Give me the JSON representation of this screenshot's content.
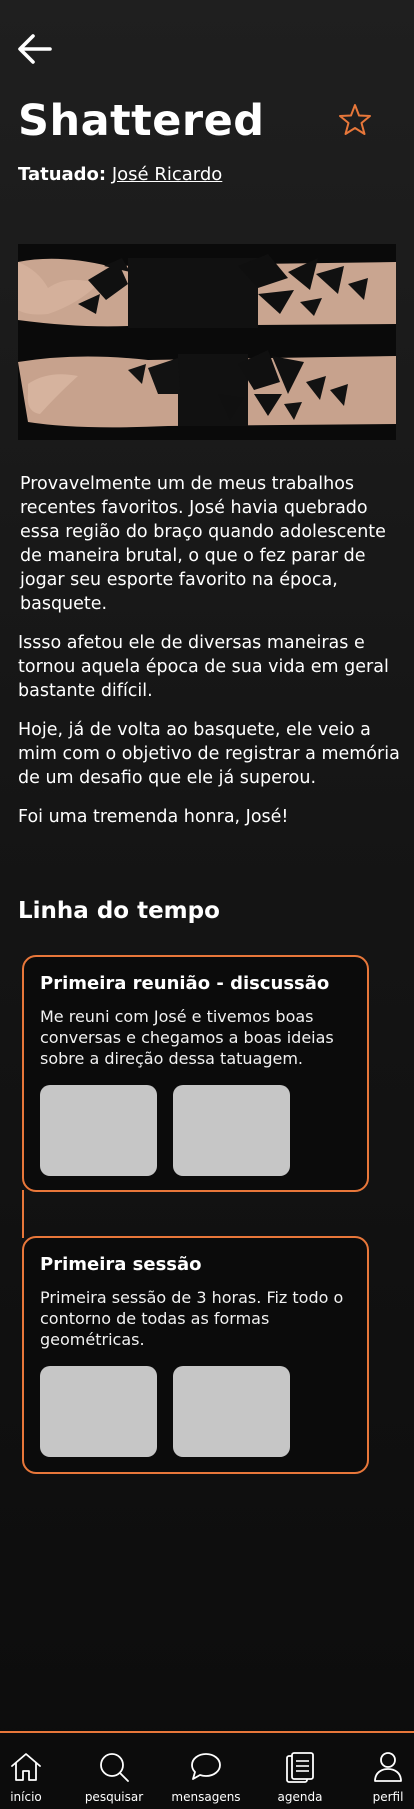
{
  "header": {
    "back_icon": "arrow-left-icon",
    "title": "Shattered",
    "favorite_icon": "star-outline-icon",
    "artist_label": "Tatuado:",
    "artist_name": "José Ricardo"
  },
  "photo": {
    "alt": "forearm-geometric-tattoo"
  },
  "description": {
    "p1": "Provavelmente um de meus trabalhos recentes favoritos. José havia quebrado essa região do braço quando adolescente de maneira brutal, o que o fez parar de jogar seu esporte favorito na época, basquete.",
    "p2": "Issso afetou ele de diversas maneiras e tornou aquela época de sua vida em geral bastante difícil.",
    "p3": "Hoje, já de volta ao basquete, ele veio a mim com o objetivo de registrar a memória de um desafio que ele já superou.",
    "p4": "Foi uma tremenda honra, José!"
  },
  "timeline": {
    "title": "Linha do tempo",
    "items": [
      {
        "title": "Primeira reunião - discussão",
        "text": "Me reuni com José e tivemos boas conversas e chegamos a boas ideias sobre a direção dessa tatuagem."
      },
      {
        "title": "Primeira sessão",
        "text": "Primeira sessão de 3 horas. Fiz todo o contorno de todas as formas geométricas."
      }
    ]
  },
  "nav": {
    "items": [
      {
        "label": "início",
        "icon": "home-icon"
      },
      {
        "label": "pesquisar",
        "icon": "search-icon"
      },
      {
        "label": "mensagens",
        "icon": "chat-icon"
      },
      {
        "label": "agenda",
        "icon": "agenda-icon"
      },
      {
        "label": "perfil",
        "icon": "profile-icon"
      }
    ]
  },
  "colors": {
    "accent": "#e8773a",
    "background": "#151515",
    "placeholder": "#c6c6c6"
  }
}
